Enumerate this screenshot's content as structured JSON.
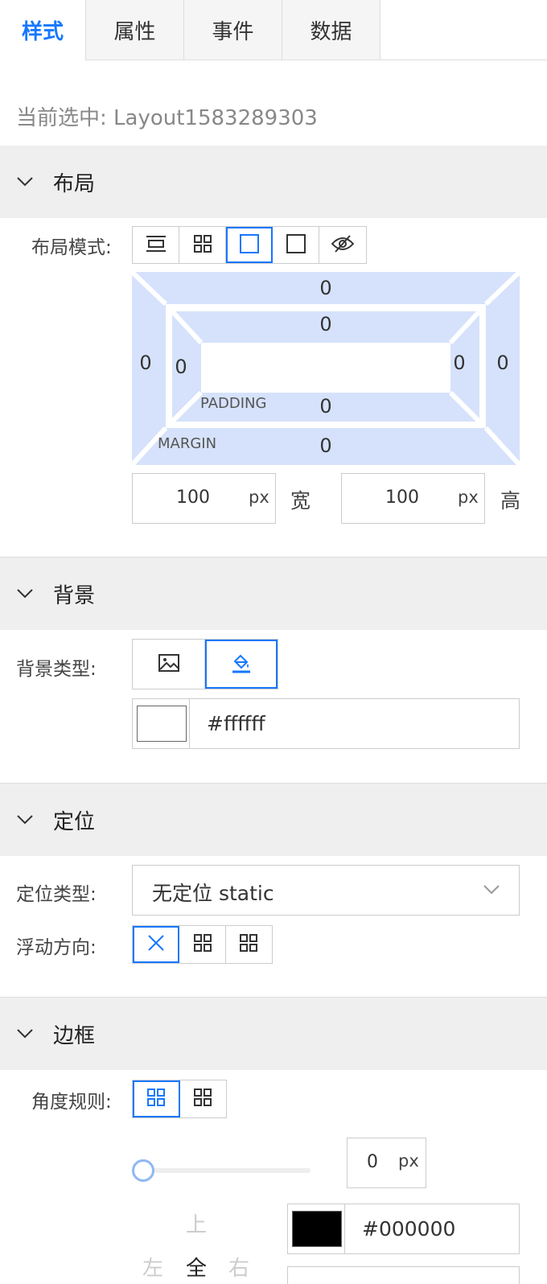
{
  "tabs": [
    "样式",
    "属性",
    "事件",
    "数据"
  ],
  "selected_text": "当前选中: Layout1583289303",
  "sections": {
    "layout": {
      "title": "布局",
      "mode_label": "布局模式:",
      "box_model": {
        "margin_label": "MARGIN",
        "padding_label": "PADDING",
        "margin": {
          "top": "0",
          "right": "0",
          "bottom": "0",
          "left": "0"
        },
        "padding": {
          "top": "0",
          "right": "0",
          "bottom": "0",
          "left": "0"
        }
      },
      "width": {
        "value": "100",
        "unit": "px",
        "label": "宽"
      },
      "height": {
        "value": "100",
        "unit": "px",
        "label": "高"
      }
    },
    "background": {
      "title": "背景",
      "type_label": "背景类型:",
      "color_value": "#ffffff",
      "swatch_color": "#ffffff"
    },
    "position": {
      "title": "定位",
      "type_label": "定位类型:",
      "type_value": "无定位 static",
      "float_label": "浮动方向:"
    },
    "border": {
      "title": "边框",
      "radius_label": "角度规则:",
      "radius_value": "0",
      "radius_unit": "px",
      "slider_value": 0,
      "side_top": "上",
      "side_left": "左",
      "side_all": "全",
      "side_right": "右",
      "color_value": "#000000",
      "swatch_color": "#000000"
    }
  },
  "colors": {
    "accent": "#1677ff",
    "box_fill": "#d6e2fb",
    "section_bg": "#efefef"
  }
}
